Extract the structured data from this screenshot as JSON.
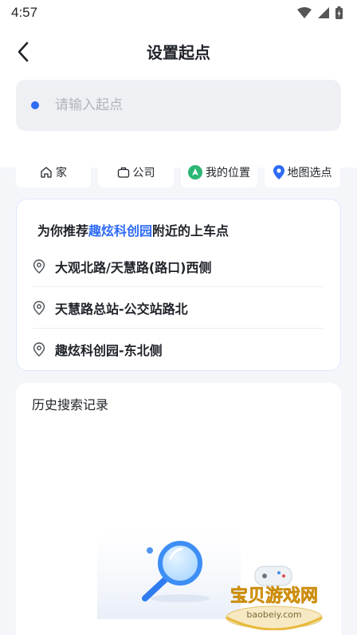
{
  "status_bar": {
    "time": "4:57"
  },
  "header": {
    "title": "设置起点"
  },
  "search": {
    "placeholder": "请输入起点"
  },
  "quick_actions": [
    {
      "label": "家",
      "icon": "home-icon"
    },
    {
      "label": "公司",
      "icon": "briefcase-icon"
    },
    {
      "label": "我的位置",
      "icon": "navigation-icon"
    },
    {
      "label": "地图选点",
      "icon": "map-pin-icon"
    }
  ],
  "recommend": {
    "title_prefix": "为你推荐",
    "title_highlight": "趣炫科创园",
    "title_suffix": "附近的上车点",
    "items": [
      {
        "label": "大观北路/天慧路(路口)西侧"
      },
      {
        "label": "天慧路总站-公交站路北"
      },
      {
        "label": "趣炫科创园-东北侧"
      }
    ]
  },
  "history": {
    "title": "历史搜索记录"
  },
  "watermark": {
    "text": "宝贝游戏网",
    "url": "baobeiy.com"
  },
  "colors": {
    "accent": "#2f6bf5",
    "nav_green": "#2bb673",
    "background": "#f4f6fa"
  }
}
